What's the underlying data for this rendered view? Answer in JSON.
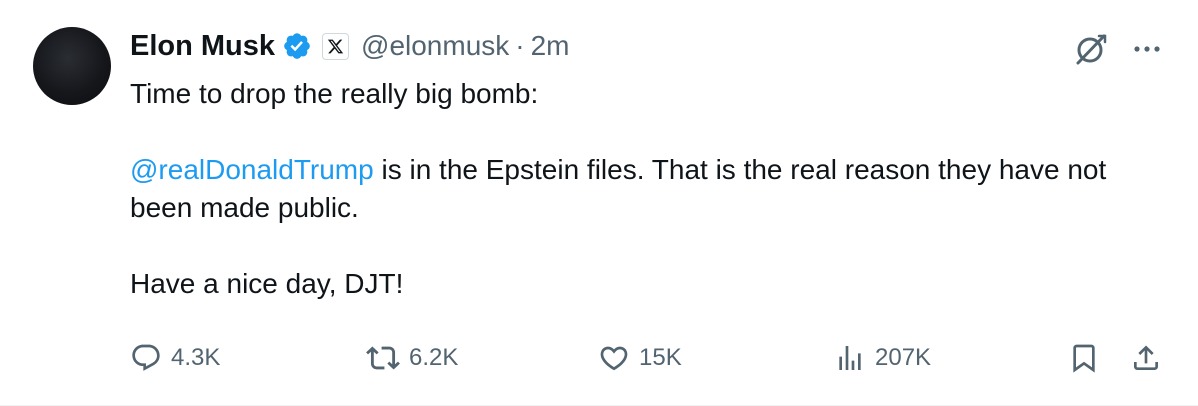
{
  "author": {
    "name": "Elon Musk",
    "handle": "@elonmusk",
    "separator": "·",
    "time": "2m"
  },
  "tweet": {
    "line1": "Time to drop the really big bomb:",
    "mention": "@realDonaldTrump",
    "line2_rest": " is in the Epstein files. That is the real reason they have not been made public.",
    "line3": "Have a nice day, DJT!"
  },
  "actions": {
    "replies": "4.3K",
    "reposts": "6.2K",
    "likes": "15K",
    "views": "207K"
  },
  "colors": {
    "accent": "#1d9bf0",
    "text": "#0f1419",
    "muted": "#536471"
  },
  "icons": {
    "verified": "verified-badge-icon",
    "affiliation": "x-logo-icon",
    "grok": "grok-icon",
    "more": "more-icon",
    "reply": "reply-icon",
    "repost": "repost-icon",
    "like": "heart-icon",
    "views": "views-icon",
    "bookmark": "bookmark-icon",
    "share": "share-icon"
  }
}
